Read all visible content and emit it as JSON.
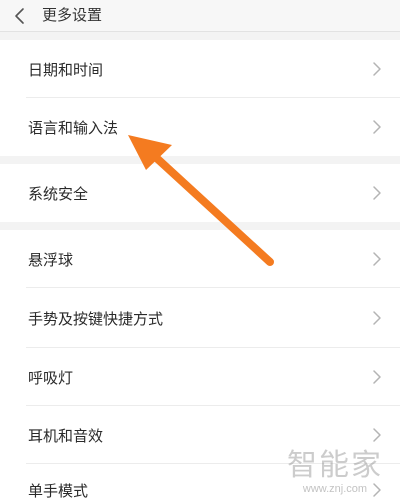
{
  "header": {
    "title": "更多设置"
  },
  "items": [
    {
      "label": "日期和时间"
    },
    {
      "label": "语言和输入法"
    },
    {
      "label": "系统安全"
    },
    {
      "label": "悬浮球"
    },
    {
      "label": "手势及按键快捷方式"
    },
    {
      "label": "呼吸灯"
    },
    {
      "label": "耳机和音效"
    },
    {
      "label": "单手模式"
    }
  ],
  "watermark": {
    "text": "智能家",
    "url": "www.znj.com"
  },
  "colors": {
    "arrow": "#f47b20",
    "background": "#f3f3f3",
    "row": "#ffffff"
  },
  "icons": {
    "back": "chevron-left-icon",
    "row_chevron": "chevron-right-icon"
  }
}
